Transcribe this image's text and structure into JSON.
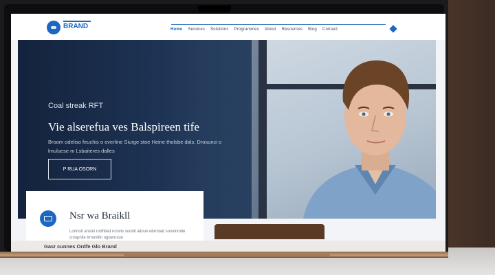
{
  "nav": {
    "logo": "BRAND",
    "links": [
      "Home",
      "Services",
      "Solutions",
      "Programmes",
      "About",
      "Resources",
      "Blog",
      "Contact"
    ]
  },
  "hero": {
    "eyebrow": "Coal streak RFT",
    "title": "Vie alserefua ves Balspireen tife",
    "subtitle": "Broom odeliso feuchis o overline Siurge stoe Heine tholsbe dals. Drosunci o lmuluese m Lsbaiteres dalles",
    "button": "P RUA OSORN"
  },
  "card": {
    "title": "Nsr wa Braikll",
    "text": "Lorlnoit anstin rodhiled ncnvis soubit alioun ebrmtad soovlnmtie cniupnlie trmovltin ogoenrxun"
  },
  "strip": {
    "text": "Gasr cunnes Ordfe Glo Brand"
  },
  "colors": {
    "accent": "#1d67c0",
    "hero_dark": "#14233d"
  }
}
